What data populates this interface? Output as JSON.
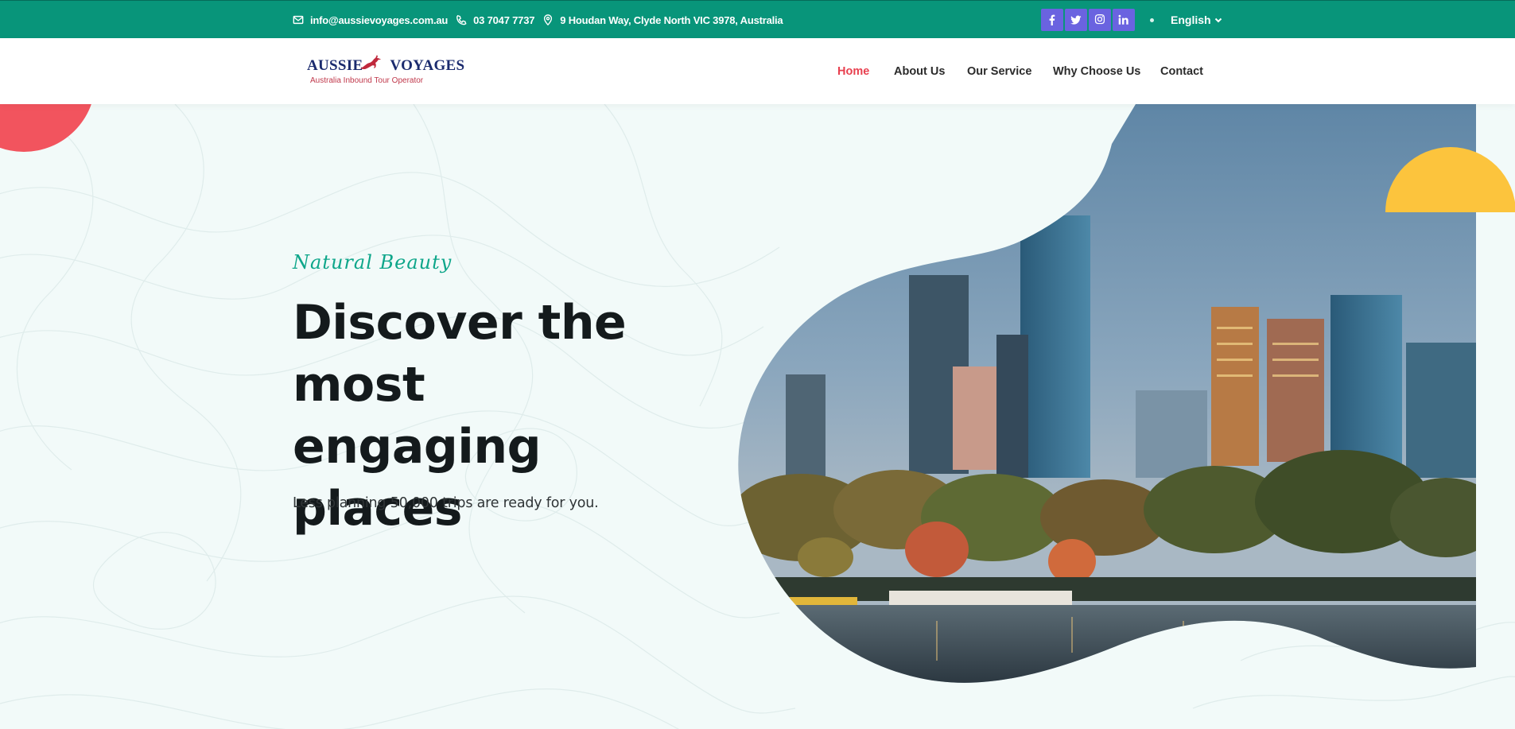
{
  "topbar": {
    "email": "info@aussievoyages.com.au",
    "phone": "03 7047 7737",
    "address": "9 Houdan Way, Clyde North VIC 3978, Australia",
    "social": [
      {
        "icon": "facebook-icon",
        "label": "f"
      },
      {
        "icon": "twitter-icon",
        "label": "t"
      },
      {
        "icon": "instagram-icon",
        "label": "ig"
      },
      {
        "icon": "linkedin-icon",
        "label": "in"
      }
    ],
    "language": "English"
  },
  "logo": {
    "word1": "AUSSIE",
    "word2": "VOYAGES",
    "tagline": "Australia Inbound Tour Operator"
  },
  "nav": {
    "items": [
      "Home",
      "About Us",
      "Our Service",
      "Why Choose Us",
      "Contact"
    ],
    "active": "Home"
  },
  "hero": {
    "tagline": "Natural Beauty",
    "title": "Discover the most engaging places",
    "subtitle": "Less planning 50,000 trips are ready for you."
  },
  "colors": {
    "topbar": "#08957a",
    "social": "#6a63e0",
    "accent_red": "#e8404f",
    "accent_yellow": "#fcc43d",
    "tagline": "#0ea68a"
  }
}
